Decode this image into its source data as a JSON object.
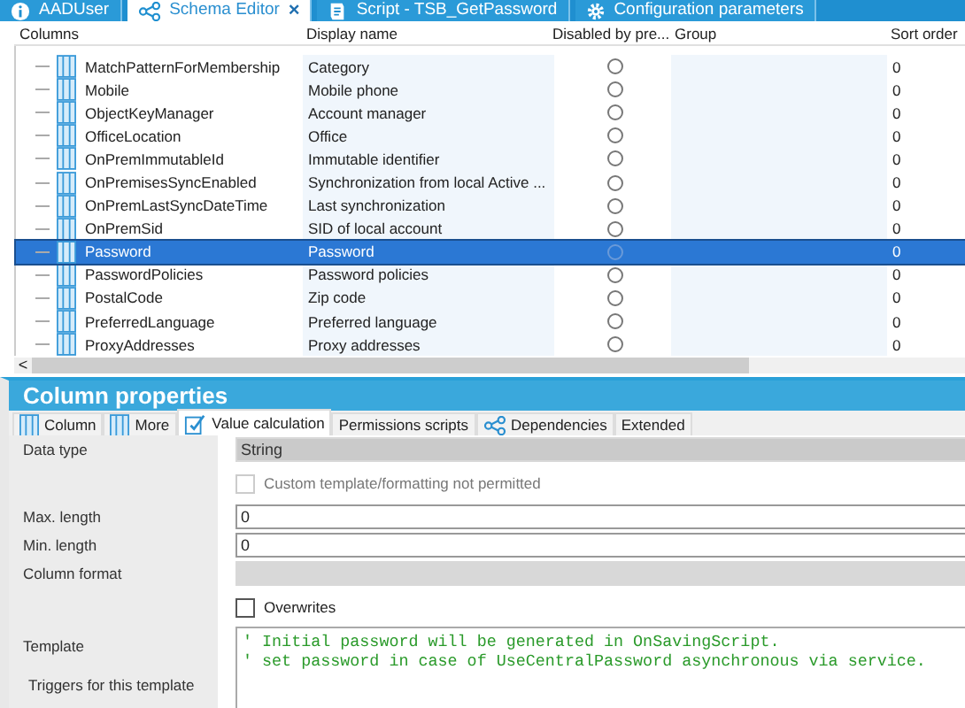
{
  "doc_tabs": [
    {
      "label": "AADUser",
      "selected": false
    },
    {
      "label": "Schema Editor",
      "selected": true,
      "close": "×"
    },
    {
      "label": "Script - TSB_GetPassword",
      "selected": false
    },
    {
      "label": "Configuration parameters",
      "selected": false
    }
  ],
  "table": {
    "columns": [
      "Columns",
      "Display name",
      "Disabled by pre...",
      "Group",
      "Sort order"
    ],
    "rows": [
      {
        "name": "MatchPatternForMembership",
        "display": "Category",
        "disabled": false,
        "sort": "0",
        "selected": false
      },
      {
        "name": "Mobile",
        "display": "Mobile phone",
        "disabled": false,
        "sort": "0",
        "selected": false
      },
      {
        "name": "ObjectKeyManager",
        "display": "Account manager",
        "disabled": false,
        "sort": "0",
        "selected": false
      },
      {
        "name": "OfficeLocation",
        "display": "Office",
        "disabled": false,
        "sort": "0",
        "selected": false
      },
      {
        "name": "OnPremImmutableId",
        "display": "Immutable identifier",
        "disabled": false,
        "sort": "0",
        "selected": false
      },
      {
        "name": "OnPremisesSyncEnabled",
        "display": "Synchronization from local Active ...",
        "disabled": false,
        "sort": "0",
        "selected": false
      },
      {
        "name": "OnPremLastSyncDateTime",
        "display": "Last synchronization",
        "disabled": false,
        "sort": "0",
        "selected": false
      },
      {
        "name": "OnPremSid",
        "display": "SID of local account",
        "disabled": false,
        "sort": "0",
        "selected": false
      },
      {
        "name": "Password",
        "display": "Password",
        "disabled": false,
        "sort": "0",
        "selected": true
      },
      {
        "name": "PasswordPolicies",
        "display": "Password policies",
        "disabled": false,
        "sort": "0",
        "selected": false
      },
      {
        "name": "PostalCode",
        "display": "Zip code",
        "disabled": false,
        "sort": "0",
        "selected": false
      },
      {
        "name": "PreferredLanguage",
        "display": "Preferred language",
        "disabled": false,
        "sort": "0",
        "selected": false
      },
      {
        "name": "ProxyAddresses",
        "display": "Proxy addresses",
        "disabled": false,
        "sort": "0",
        "selected": false
      }
    ]
  },
  "scroll_left": "<",
  "panel": {
    "title": "Column properties",
    "tabs": [
      {
        "label": "Column",
        "selected": false
      },
      {
        "label": "More",
        "selected": false
      },
      {
        "label": "Value calculation",
        "selected": true
      },
      {
        "label": "Permissions scripts",
        "selected": false
      },
      {
        "label": "Dependencies",
        "selected": false
      },
      {
        "label": "Extended",
        "selected": false
      }
    ],
    "fields": [
      {
        "kind": "readonly",
        "label": "Data type",
        "value": "String"
      },
      {
        "kind": "checkbox",
        "label": "Custom template/formatting not permitted",
        "checked": false,
        "disabled": true
      },
      {
        "kind": "text",
        "label": "Max. length",
        "value": "0"
      },
      {
        "kind": "text",
        "label": "Min. length",
        "value": "0"
      },
      {
        "kind": "readonly",
        "label": "Column format"
      },
      {
        "kind": "checkbox",
        "label": "Overwrites",
        "checked": false,
        "disabled": false
      },
      {
        "kind": "code",
        "label": "Template",
        "sublabel": "Triggers for this template",
        "lines": [
          "' Initial password will be generated in OnSavingScript.",
          "' set password in case of UseCentralPassword asynchronous via service."
        ]
      }
    ]
  }
}
